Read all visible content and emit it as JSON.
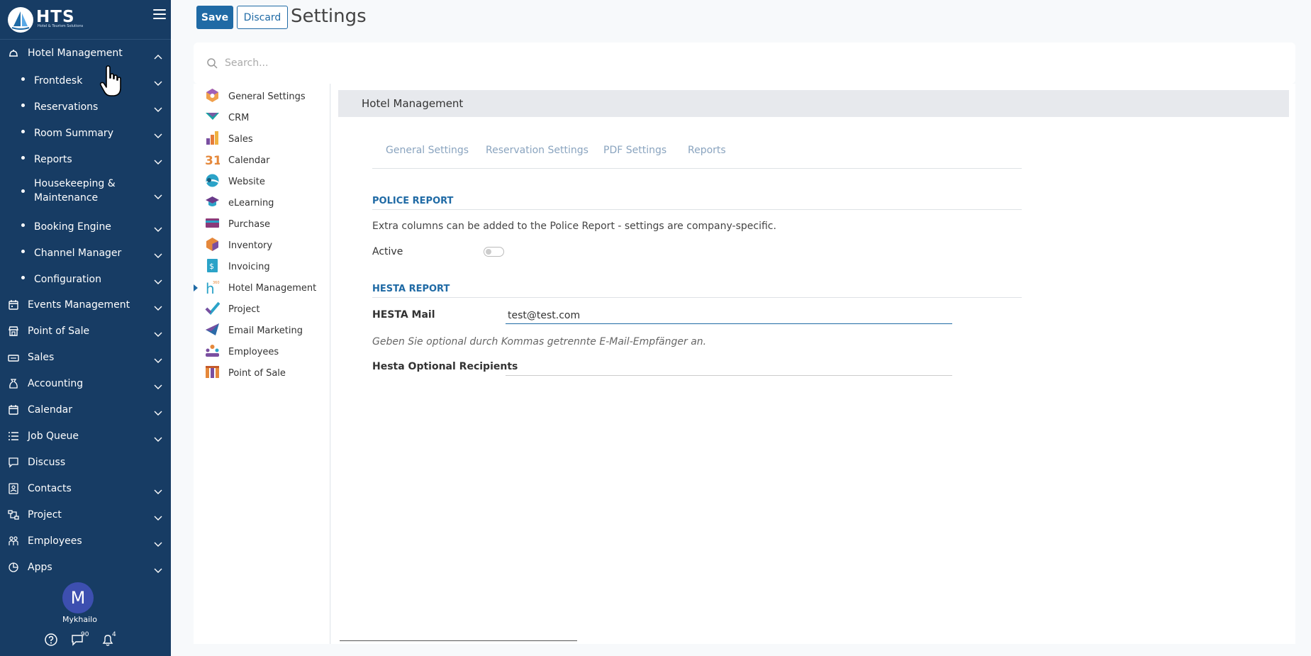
{
  "brand": {
    "name": "HTS",
    "subtitle": "Hotel & Tourism Solutions"
  },
  "sidebar": {
    "items": [
      {
        "label": "Hotel Management",
        "icon": "hotel-bell-icon",
        "expanded": true
      },
      {
        "label": "Events Management",
        "icon": "calendar-event-icon"
      },
      {
        "label": "Point of Sale",
        "icon": "store-icon"
      },
      {
        "label": "Sales",
        "icon": "sales-icon"
      },
      {
        "label": "Accounting",
        "icon": "money-bag-icon"
      },
      {
        "label": "Calendar",
        "icon": "calendar-icon"
      },
      {
        "label": "Job Queue",
        "icon": "list-icon"
      },
      {
        "label": "Discuss",
        "icon": "chat-icon"
      },
      {
        "label": "Contacts",
        "icon": "contacts-icon"
      },
      {
        "label": "Project",
        "icon": "project-icon"
      },
      {
        "label": "Employees",
        "icon": "employees-icon"
      },
      {
        "label": "Apps",
        "icon": "apps-icon"
      }
    ],
    "sub_items": [
      {
        "label": "Frontdesk"
      },
      {
        "label": "Reservations"
      },
      {
        "label": "Room Summary"
      },
      {
        "label": "Reports"
      },
      {
        "label": "Housekeeping & Maintenance"
      },
      {
        "label": "Booking Engine"
      },
      {
        "label": "Channel Manager"
      },
      {
        "label": "Configuration"
      }
    ]
  },
  "user": {
    "initial": "M",
    "name": "Mykhailo",
    "messages_count": "90",
    "notifications_count": "4"
  },
  "toolbar": {
    "save_label": "Save",
    "discard_label": "Discard",
    "title": "Settings"
  },
  "search": {
    "placeholder": "Search..."
  },
  "apps": [
    {
      "label": "General Settings",
      "icon": "general-settings-icon"
    },
    {
      "label": "CRM",
      "icon": "crm-icon"
    },
    {
      "label": "Sales",
      "icon": "sales-app-icon"
    },
    {
      "label": "Calendar",
      "icon": "calendar-app-icon"
    },
    {
      "label": "Website",
      "icon": "website-icon"
    },
    {
      "label": "eLearning",
      "icon": "elearning-icon"
    },
    {
      "label": "Purchase",
      "icon": "purchase-icon"
    },
    {
      "label": "Inventory",
      "icon": "inventory-icon"
    },
    {
      "label": "Invoicing",
      "icon": "invoicing-icon"
    },
    {
      "label": "Hotel Management",
      "icon": "hotel-management-icon",
      "selected": true
    },
    {
      "label": "Project",
      "icon": "project-app-icon"
    },
    {
      "label": "Email Marketing",
      "icon": "email-marketing-icon"
    },
    {
      "label": "Employees",
      "icon": "employees-app-icon"
    },
    {
      "label": "Point of Sale",
      "icon": "pos-app-icon"
    }
  ],
  "main": {
    "section_title": "Hotel Management",
    "tabs": [
      {
        "label": "General Settings"
      },
      {
        "label": "Reservation Settings"
      },
      {
        "label": "PDF Settings"
      },
      {
        "label": "Reports"
      }
    ],
    "police": {
      "title": "POLICE REPORT",
      "description": "Extra columns can be added to the Police Report - settings are company-specific.",
      "active_label": "Active",
      "active": false
    },
    "hesta": {
      "title": "HESTA REPORT",
      "mail_label": "HESTA Mail",
      "mail_value": "test@test.com",
      "hint": "Geben Sie optional durch Kommas getrennte E-Mail-Empfänger an.",
      "recipients_label": "Hesta Optional Recipients",
      "recipients_value": ""
    }
  },
  "colors": {
    "sidebar_bg": "#173c64",
    "accent": "#1f6aa5",
    "tab_inactive": "#8aa4bf",
    "section_header_bg": "#e7e9ed"
  }
}
